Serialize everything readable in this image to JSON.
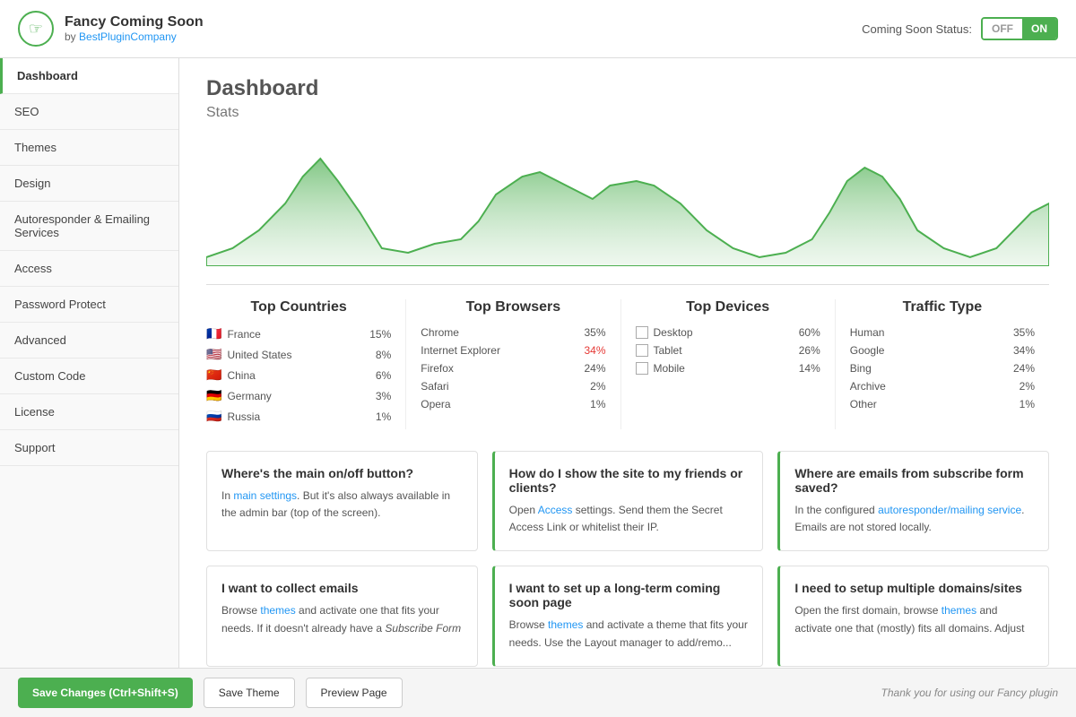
{
  "header": {
    "app_name": "Fancy Coming Soon",
    "app_subtitle": "by",
    "app_author": "BestPluginCompany",
    "coming_soon_status_label": "Coming Soon Status:",
    "toggle_off": "OFF",
    "toggle_on": "ON"
  },
  "sidebar": {
    "items": [
      {
        "id": "dashboard",
        "label": "Dashboard",
        "active": true
      },
      {
        "id": "seo",
        "label": "SEO",
        "active": false
      },
      {
        "id": "themes",
        "label": "Themes",
        "active": false
      },
      {
        "id": "design",
        "label": "Design",
        "active": false
      },
      {
        "id": "autoresponder",
        "label": "Autoresponder & Emailing Services",
        "active": false
      },
      {
        "id": "access",
        "label": "Access",
        "active": false
      },
      {
        "id": "password-protect",
        "label": "Password Protect",
        "active": false
      },
      {
        "id": "advanced",
        "label": "Advanced",
        "active": false
      },
      {
        "id": "custom-code",
        "label": "Custom Code",
        "active": false
      },
      {
        "id": "license",
        "label": "License",
        "active": false
      },
      {
        "id": "support",
        "label": "Support",
        "active": false
      }
    ]
  },
  "dashboard": {
    "title": "Dashboard",
    "stats_label": "Stats",
    "top_countries": {
      "title": "Top Countries",
      "items": [
        {
          "flag": "🇫🇷",
          "name": "France",
          "pct": "15%",
          "highlight": false
        },
        {
          "flag": "🇺🇸",
          "name": "United States",
          "pct": "8%",
          "highlight": false
        },
        {
          "flag": "🇨🇳",
          "name": "China",
          "pct": "6%",
          "highlight": false
        },
        {
          "flag": "🇩🇪",
          "name": "Germany",
          "pct": "3%",
          "highlight": false
        },
        {
          "flag": "🇷🇺",
          "name": "Russia",
          "pct": "1%",
          "highlight": false
        }
      ]
    },
    "top_browsers": {
      "title": "Top Browsers",
      "items": [
        {
          "name": "Chrome",
          "pct": "35%",
          "highlight": false
        },
        {
          "name": "Internet Explorer",
          "pct": "34%",
          "highlight": true
        },
        {
          "name": "Firefox",
          "pct": "24%",
          "highlight": false
        },
        {
          "name": "Safari",
          "pct": "2%",
          "highlight": false
        },
        {
          "name": "Opera",
          "pct": "1%",
          "highlight": false
        }
      ]
    },
    "top_devices": {
      "title": "Top Devices",
      "items": [
        {
          "name": "Desktop",
          "pct": "60%"
        },
        {
          "name": "Tablet",
          "pct": "26%"
        },
        {
          "name": "Mobile",
          "pct": "14%"
        }
      ]
    },
    "traffic_type": {
      "title": "Traffic Type",
      "items": [
        {
          "name": "Human",
          "pct": "35%"
        },
        {
          "name": "Google",
          "pct": "34%"
        },
        {
          "name": "Bing",
          "pct": "24%"
        },
        {
          "name": "Archive",
          "pct": "2%"
        },
        {
          "name": "Other",
          "pct": "1%"
        }
      ]
    }
  },
  "cards": [
    {
      "id": "card1",
      "title": "Where's the main on/off button?",
      "text_parts": [
        {
          "type": "text",
          "value": "In "
        },
        {
          "type": "link",
          "value": "main settings"
        },
        {
          "type": "text",
          "value": ". But it's also always available in the admin bar (top of the screen)."
        }
      ],
      "green_border": false
    },
    {
      "id": "card2",
      "title": "How do I show the site to my friends or clients?",
      "text_parts": [
        {
          "type": "text",
          "value": "Open "
        },
        {
          "type": "link",
          "value": "Access"
        },
        {
          "type": "text",
          "value": " settings. Send them the Secret Access Link or whitelist their IP."
        }
      ],
      "green_border": true
    },
    {
      "id": "card3",
      "title": "Where are emails from subscribe form saved?",
      "text_parts": [
        {
          "type": "text",
          "value": "In the configured "
        },
        {
          "type": "link",
          "value": "autoresponder/mailing service"
        },
        {
          "type": "text",
          "value": ". Emails are not stored locally."
        }
      ],
      "green_border": true
    },
    {
      "id": "card4",
      "title": "I want to collect emails",
      "text_parts": [
        {
          "type": "text",
          "value": "Browse "
        },
        {
          "type": "link",
          "value": "themes"
        },
        {
          "type": "text",
          "value": " and activate one that fits your needs. If it doesn't already have a "
        },
        {
          "type": "em",
          "value": "Subscribe Form"
        }
      ],
      "green_border": false
    },
    {
      "id": "card5",
      "title": "I want to set up a long-term coming soon page",
      "text_parts": [
        {
          "type": "text",
          "value": "Browse "
        },
        {
          "type": "link",
          "value": "themes"
        },
        {
          "type": "text",
          "value": " and activate a theme that fits your needs. Use the Layout manager to add/remo..."
        }
      ],
      "green_border": true
    },
    {
      "id": "card6",
      "title": "I need to setup multiple domains/sites",
      "text_parts": [
        {
          "type": "text",
          "value": "Open the first domain, browse "
        },
        {
          "type": "link",
          "value": "themes"
        },
        {
          "type": "text",
          "value": " and activate one that (mostly) fits all domains. Adjust"
        }
      ],
      "green_border": true
    }
  ],
  "footer": {
    "save_changes_label": "Save Changes (Ctrl+Shift+S)",
    "save_theme_label": "Save Theme",
    "preview_page_label": "Preview Page",
    "thank_you": "Thank you for using our Fancy plugin"
  }
}
